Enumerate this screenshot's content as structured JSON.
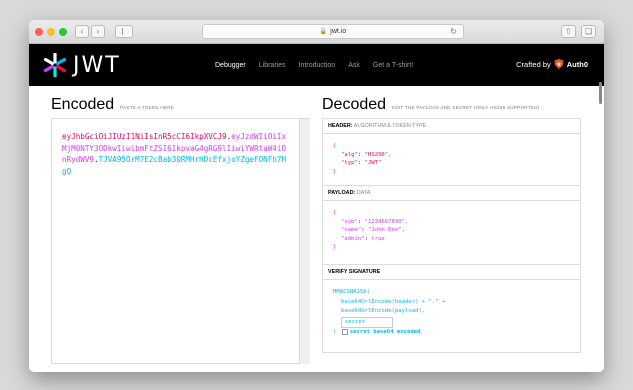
{
  "browser": {
    "url": "jwt.io",
    "back_icon": "chevron-left",
    "forward_icon": "chevron-right"
  },
  "site": {
    "logo_text": "JWT",
    "nav": [
      "Debugger",
      "Libraries",
      "Introduction",
      "Ask",
      "Get a T-shirt!"
    ],
    "crafted_by": "Crafted by",
    "crafted_brand": "Auth0"
  },
  "encoded": {
    "title": "Encoded",
    "hint": "PASTE A TOKEN HERE",
    "token_header": "eyJhbGciOiJIUzI1NiIsInR5cCI6IkpXVCJ9",
    "token_payload": "eyJzdWIiOiIxMjM0NTY3ODkwIiwibmFtZSI6IkpvaG4gRG9lIiwiYWRtaW4iOnRydWV9",
    "token_signature": "TJVA95OrM7E2cBab30RMHrHDcEfxjoYZgeFONFh7HgQ"
  },
  "decoded": {
    "title": "Decoded",
    "hint": "EDIT THE PAYLOAD AND SECRET (ONLY HS256 SUPPORTED)",
    "header_label": "HEADER:",
    "header_sub": "ALGORITHM & TOKEN TYPE",
    "header_json": {
      "alg_key": "\"alg\"",
      "alg_val": "\"HS256\",",
      "typ_key": "\"typ\"",
      "typ_val": "\"JWT\""
    },
    "payload_label": "PAYLOAD:",
    "payload_sub": "DATA",
    "payload_json": {
      "sub_key": "\"sub\"",
      "sub_val": "\"1234567890\",",
      "name_key": "\"name\"",
      "name_val": "\"John Doe\",",
      "admin_key": "\"admin\"",
      "admin_val": "true"
    },
    "signature_label": "VERIFY SIGNATURE",
    "sig_func": "HMACSHA256(",
    "sig_line1": "base64UrlEncode(header) + \".\" +",
    "sig_line2": "base64UrlEncode(payload),",
    "secret_placeholder": "secret",
    "sig_close": ")",
    "secret_b64_label": "secret base64 encoded"
  },
  "colors": {
    "header_red": "#fb015b",
    "payload_purple": "#d63aff",
    "signature_blue": "#00b9f1"
  }
}
